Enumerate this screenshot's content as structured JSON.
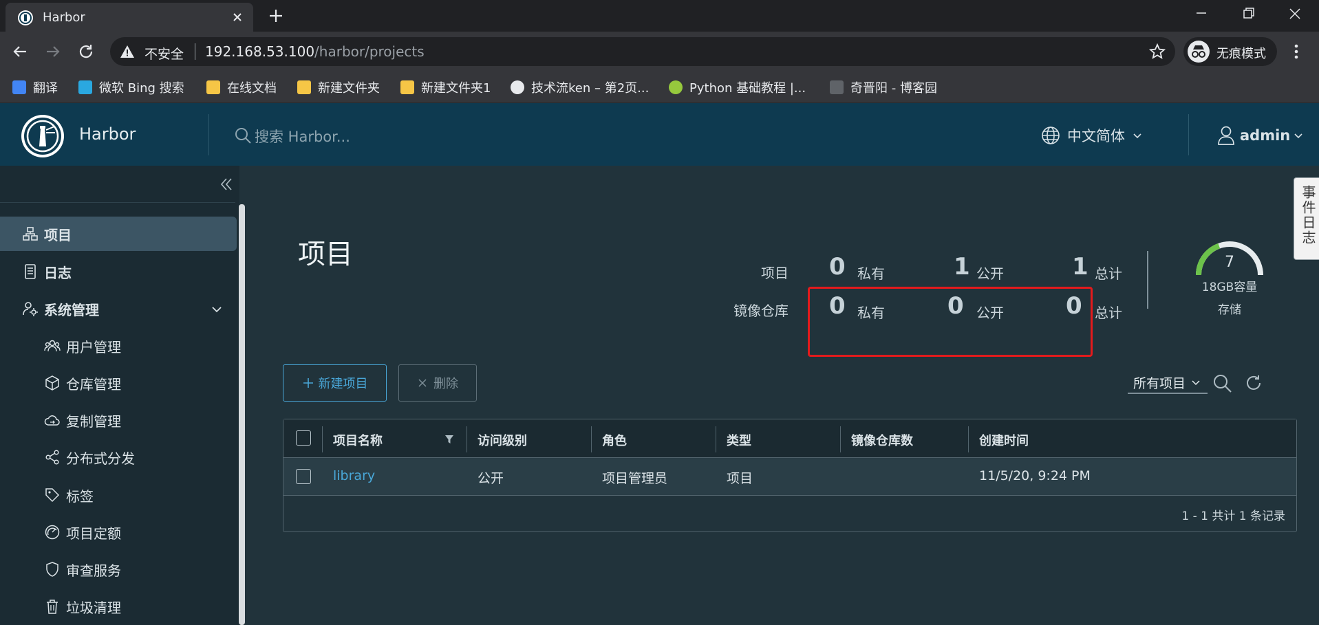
{
  "browser": {
    "tab_title": "Harbor",
    "security_label": "不安全",
    "url_host": "192.168.53.100",
    "url_path": "/harbor/projects",
    "incognito_label": "无痕模式",
    "bookmarks": [
      {
        "label": "翻译",
        "icon_color": "#4285f4"
      },
      {
        "label": "微软 Bing 搜索",
        "icon_color": "#2aa8e0"
      },
      {
        "label": "在线文档",
        "icon_color": "#f6c646"
      },
      {
        "label": "新建文件夹",
        "icon_color": "#f6c646"
      },
      {
        "label": "新建文件夹1",
        "icon_color": "#f6c646"
      },
      {
        "label": "技术流ken – 第2页...",
        "icon_color": "#e8eaed"
      },
      {
        "label": "Python 基础教程 |...",
        "icon_color": "#96c93d"
      },
      {
        "label": "奇晋阳 - 博客园",
        "icon_color": "#5f6368"
      }
    ]
  },
  "header": {
    "brand": "Harbor",
    "search_placeholder": "搜索 Harbor...",
    "language": "中文简体",
    "user": "admin"
  },
  "sidebar": {
    "items": [
      {
        "label": "项目",
        "icon": "projects-icon",
        "active": true,
        "level": "top"
      },
      {
        "label": "日志",
        "icon": "logs-icon",
        "level": "top"
      },
      {
        "label": "系统管理",
        "icon": "admin-gear-icon",
        "level": "top",
        "expanded": true
      },
      {
        "label": "用户管理",
        "icon": "users-icon",
        "level": "sub"
      },
      {
        "label": "仓库管理",
        "icon": "registry-box-icon",
        "level": "sub"
      },
      {
        "label": "复制管理",
        "icon": "cloud-replication-icon",
        "level": "sub"
      },
      {
        "label": "分布式分发",
        "icon": "share-distribution-icon",
        "level": "sub"
      },
      {
        "label": "标签",
        "icon": "tag-icon",
        "level": "sub"
      },
      {
        "label": "项目定额",
        "icon": "quota-gauge-icon",
        "level": "sub"
      },
      {
        "label": "审查服务",
        "icon": "shield-icon",
        "level": "sub"
      },
      {
        "label": "垃圾清理",
        "icon": "trash-icon",
        "level": "sub"
      }
    ]
  },
  "main": {
    "title": "项目",
    "stats": {
      "row1_label": "项目",
      "row2_label": "镜像仓库",
      "projects": {
        "private": "0",
        "public": "1",
        "total": "1"
      },
      "repositories": {
        "private": "0",
        "public": "0",
        "total": "0"
      },
      "unit_private": "私有",
      "unit_public": "公开",
      "unit_total": "总计"
    },
    "storage": {
      "value": "7",
      "capacity": "18GB容量",
      "label": "存储",
      "used_fraction": 0.39
    },
    "buttons": {
      "new_project": "新建项目",
      "delete": "删除"
    },
    "filter": "所有项目",
    "table": {
      "columns": [
        "项目名称",
        "访问级别",
        "角色",
        "类型",
        "镜像仓库数",
        "创建时间"
      ],
      "rows": [
        {
          "name": "library",
          "access": "公开",
          "role": "项目管理员",
          "type": "项目",
          "repo_count": "",
          "created": "11/5/20, 9:24 PM"
        }
      ],
      "footer": "1 - 1 共计 1 条记录"
    },
    "event_log_tab": "事件日志"
  },
  "colors": {
    "header_bg": "#0e3a50",
    "sidebar_bg": "#1b2b33",
    "main_bg": "#21333b",
    "accent": "#49a7d8",
    "highlight_box": "#e31a1c",
    "gauge_green": "#6cc24a"
  }
}
